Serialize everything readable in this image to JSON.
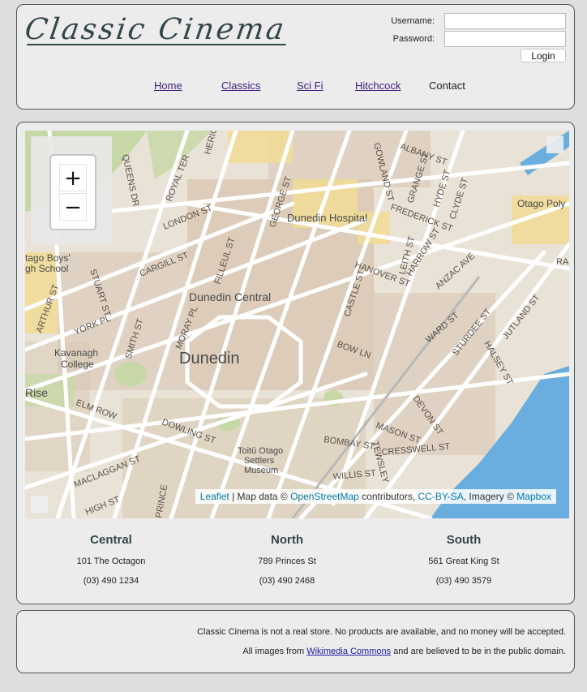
{
  "header": {
    "logo_text": "Classic Cinema",
    "login": {
      "username_label": "Username:",
      "password_label": "Password:",
      "username_value": "",
      "password_value": "",
      "login_button": "Login"
    },
    "nav": [
      {
        "label": "Home",
        "link": true
      },
      {
        "label": "Classics",
        "link": true
      },
      {
        "label": "Sci Fi",
        "link": true
      },
      {
        "label": "Hitchcock",
        "link": true
      },
      {
        "label": "Contact",
        "link": false
      }
    ]
  },
  "map": {
    "zoom_in": "+",
    "zoom_out": "−",
    "labels": {
      "albany": "ALBANY ST",
      "gowland": "GOWLAND ST",
      "grange": "GRANGE ST",
      "hyde": "HYDE ST",
      "clyde": "CLYDE ST",
      "otago_poly": "Otago Poly",
      "queens": "QUEENS DR",
      "royal": "ROYAL TER",
      "heriot": "HERIOT ROW",
      "george": "GEORGE ST",
      "hospital": "Dunedin Hospital",
      "frederick": "FREDERICK ST",
      "london": "LONDON ST",
      "filleul": "FILLEUL ST",
      "harrow": "HARROW ST",
      "ra": "RA",
      "otago_boys": "tago Boys'",
      "high_school_1": "gh School",
      "cargill": "CARGILL ST",
      "hanover": "HANOVER ST",
      "leith": "LEITH ST",
      "anzac": "ANZAC AVE",
      "stuart": "STUART ST",
      "arthur": "ARTHUR ST",
      "dunedin_central": "Dunedin Central",
      "castle": "CASTLE ST",
      "york": "YORK PL",
      "moray": "MORAY PL",
      "smith": "SMITH ST",
      "ward": "WARD ST",
      "sturdee": "STURDEE ST",
      "halsey": "HALSEY ST",
      "jutland": "JUTLAND ST",
      "kavanagh": "Kavanagh",
      "college": "College",
      "dunedin": "Dunedin",
      "bow": "BOW LN",
      "rise": "Rise",
      "elm": "ELM ROW",
      "devon": "DEVON ST",
      "dowling": "DOWLING ST",
      "mason": "MASON ST",
      "bombay": "BOMBAY ST",
      "tewsley": "TEWSLEY",
      "cresswell": "CRESSWELL ST",
      "toitu1": "Toitū Otago",
      "toitu2": "Settlers",
      "toitu3": "Museum",
      "maclaggan": "MACLAGGAN ST",
      "willis": "WILLIS ST",
      "high": "HIGH ST",
      "princes": "PRINCE"
    },
    "attribution": {
      "leaflet": "Leaflet",
      "sep1": " | Map data © ",
      "osm": "OpenStreetMap",
      "contrib": " contributors, ",
      "ccbysa": "CC-BY-SA",
      "imagery": ", Imagery © ",
      "mapbox": "Mapbox"
    },
    "colors": {
      "land": "#e9e2d6",
      "block": "#d9c8b4",
      "park": "#c5d8a5",
      "water": "#6aaee0",
      "road": "#ffffff",
      "yellow": "#f0dc98"
    }
  },
  "stores": [
    {
      "name": "Central",
      "address": "101 The Octagon",
      "phone": "(03) 490 1234"
    },
    {
      "name": "North",
      "address": "789 Princes St",
      "phone": "(03) 490 2468"
    },
    {
      "name": "South",
      "address": "561 Great King St",
      "phone": "(03) 490 3579"
    }
  ],
  "footer": {
    "line1": "Classic Cinema is not a real store. No products are available, and no money will be accepted.",
    "line2_pre": "All images from ",
    "line2_link": "Wikimedia Commons",
    "line2_post": " and are believed to be in the public domain."
  }
}
